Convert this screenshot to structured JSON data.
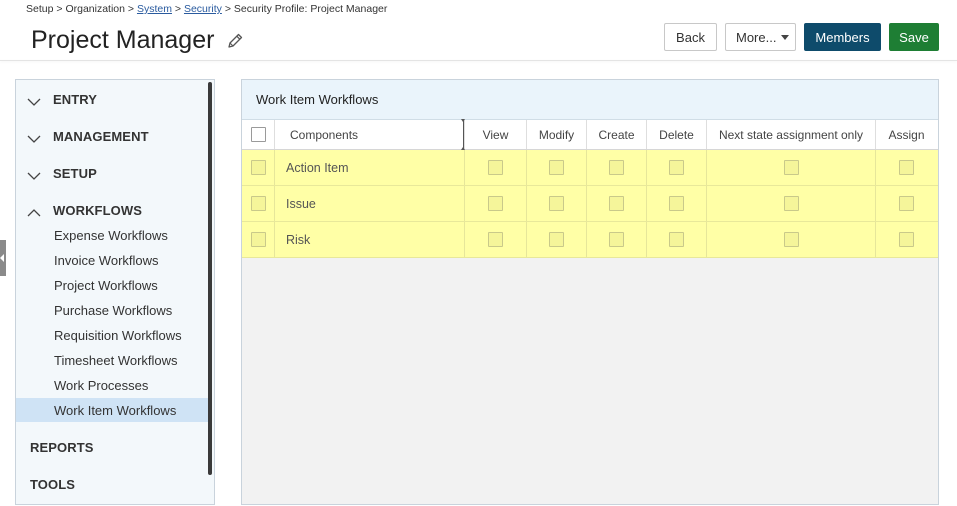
{
  "breadcrumb": {
    "setup": "Setup",
    "sep1": ">",
    "organization": "Organization",
    "sep2": ">",
    "system": "System",
    "sep3": ">",
    "security": "Security",
    "sep4": ">",
    "current": "Security Profile: Project Manager"
  },
  "header": {
    "title": "Project Manager",
    "back_label": "Back",
    "more_label": "More...",
    "members_label": "Members",
    "save_label": "Save"
  },
  "colors": {
    "members_button": "#0e4b6b",
    "save_button": "#1e7e34",
    "row_highlight": "#ffffa6",
    "active_nav": "#cfe3f5"
  },
  "sidebar": {
    "sections": [
      {
        "label": "ENTRY",
        "state": "collapsed"
      },
      {
        "label": "MANAGEMENT",
        "state": "collapsed"
      },
      {
        "label": "SETUP",
        "state": "collapsed"
      },
      {
        "label": "WORKFLOWS",
        "state": "expanded"
      },
      {
        "label": "REPORTS",
        "state": "none"
      },
      {
        "label": "TOOLS",
        "state": "none"
      }
    ],
    "workflow_items": [
      {
        "label": "Expense Workflows",
        "active": false
      },
      {
        "label": "Invoice Workflows",
        "active": false
      },
      {
        "label": "Project Workflows",
        "active": false
      },
      {
        "label": "Purchase Workflows",
        "active": false
      },
      {
        "label": "Requisition Workflows",
        "active": false
      },
      {
        "label": "Timesheet Workflows",
        "active": false
      },
      {
        "label": "Work Processes",
        "active": false
      },
      {
        "label": "Work Item Workflows",
        "active": true
      }
    ]
  },
  "panel": {
    "title": "Work Item Workflows",
    "columns": [
      "Components",
      "View",
      "Modify",
      "Create",
      "Delete",
      "Next state assignment only",
      "Assign"
    ],
    "rows": [
      {
        "component": "Action Item",
        "view": false,
        "modify": false,
        "create": false,
        "delete": false,
        "next_state": false,
        "assign": false
      },
      {
        "component": "Issue",
        "view": false,
        "modify": false,
        "create": false,
        "delete": false,
        "next_state": false,
        "assign": false
      },
      {
        "component": "Risk",
        "view": false,
        "modify": false,
        "create": false,
        "delete": false,
        "next_state": false,
        "assign": false
      }
    ]
  }
}
